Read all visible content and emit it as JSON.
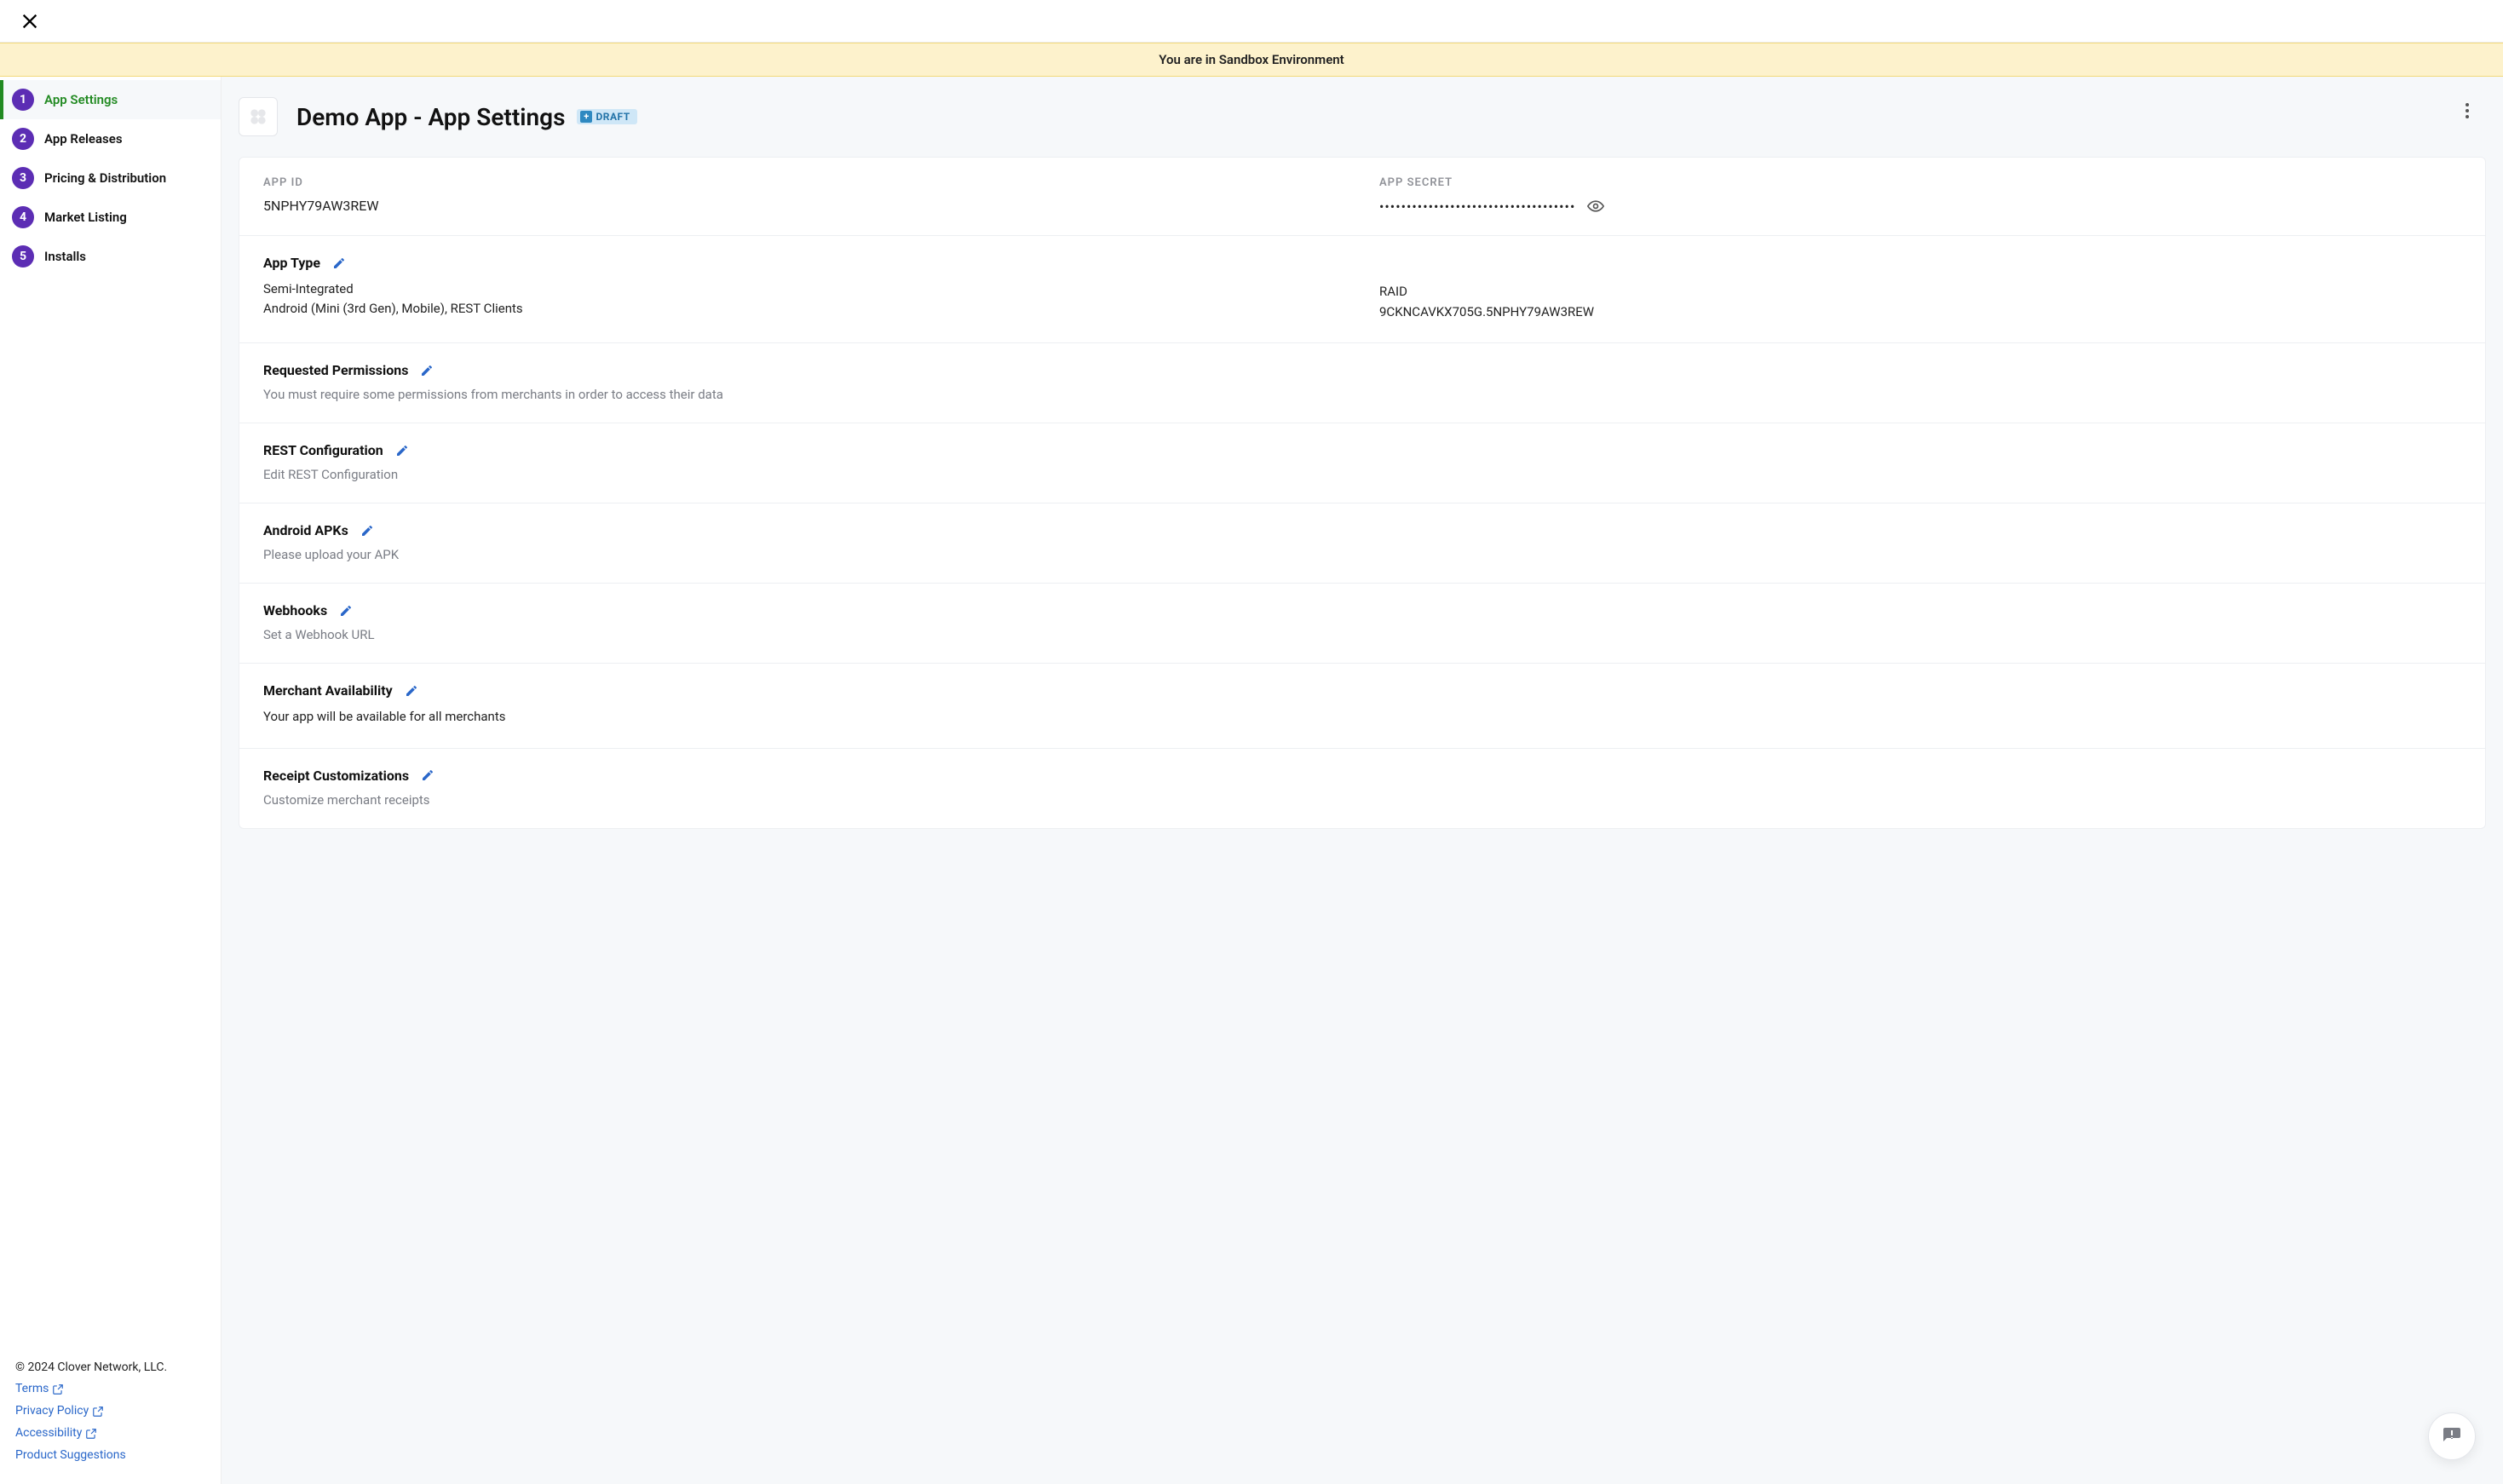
{
  "banner": "You are in Sandbox Environment",
  "sidebar": {
    "items": [
      {
        "label": "App Settings"
      },
      {
        "label": "App Releases"
      },
      {
        "label": "Pricing & Distribution"
      },
      {
        "label": "Market Listing"
      },
      {
        "label": "Installs"
      }
    ],
    "footer": {
      "copyright": "© 2024 Clover Network, LLC.",
      "links": [
        {
          "label": "Terms"
        },
        {
          "label": "Privacy Policy"
        },
        {
          "label": "Accessibility"
        },
        {
          "label": "Product Suggestions"
        }
      ]
    }
  },
  "header": {
    "title": "Demo App - App Settings",
    "badge": "DRAFT"
  },
  "appinfo": {
    "id_label": "APP ID",
    "id_value": "5NPHY79AW3REW",
    "secret_label": "APP SECRET",
    "secret_masked": "••••••••••••••••••••••••••••••••••••"
  },
  "sections": {
    "apptype": {
      "title": "App Type",
      "line1": "Semi-Integrated",
      "line2": "Android (Mini (3rd Gen), Mobile), REST Clients",
      "raid_label": "RAID",
      "raid_value": "9CKNCAVKX705G.5NPHY79AW3REW"
    },
    "permissions": {
      "title": "Requested Permissions",
      "desc": "You must require some permissions from merchants in order to access their data"
    },
    "rest": {
      "title": "REST Configuration",
      "desc": "Edit REST Configuration"
    },
    "apks": {
      "title": "Android APKs",
      "desc": "Please upload your APK"
    },
    "webhooks": {
      "title": "Webhooks",
      "desc": "Set a Webhook URL"
    },
    "availability": {
      "title": "Merchant Availability",
      "desc": "Your app will be available for all merchants"
    },
    "receipts": {
      "title": "Receipt Customizations",
      "desc": "Customize merchant receipts"
    }
  }
}
